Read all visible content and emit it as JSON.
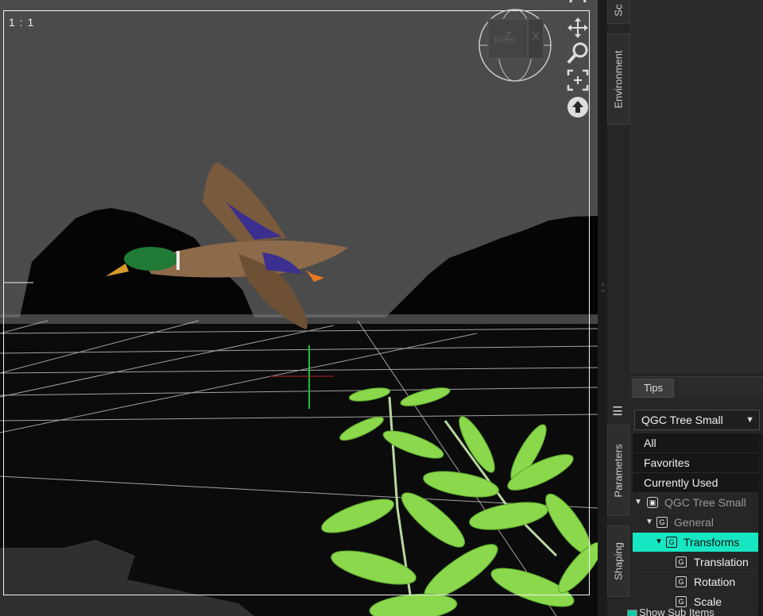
{
  "viewport": {
    "aspect_label": "1 : 1",
    "view_cube_label": "Front",
    "nav_tools": [
      "orbit-icon",
      "pan-icon",
      "zoom-icon",
      "frame-icon",
      "reset-icon"
    ]
  },
  "side_tabs": {
    "top_cut": "Sc",
    "environment": "Environment",
    "parameters": "Parameters",
    "shaping": "Shaping"
  },
  "tips_tab": "Tips",
  "parameters_panel": {
    "selected_node": "QGC Tree Small",
    "filters": [
      "All",
      "Favorites",
      "Currently Used"
    ],
    "tree": {
      "root": "QGC Tree Small",
      "general": "General",
      "transforms": "Transforms",
      "items": [
        "Translation",
        "Rotation",
        "Scale"
      ]
    },
    "show_sub_items": "Show Sub Items"
  },
  "colors": {
    "selection": "#17e6c2",
    "viewport_bg": "#4a4a4a",
    "axis_y": "#17c23a",
    "axis_x": "#c22"
  }
}
